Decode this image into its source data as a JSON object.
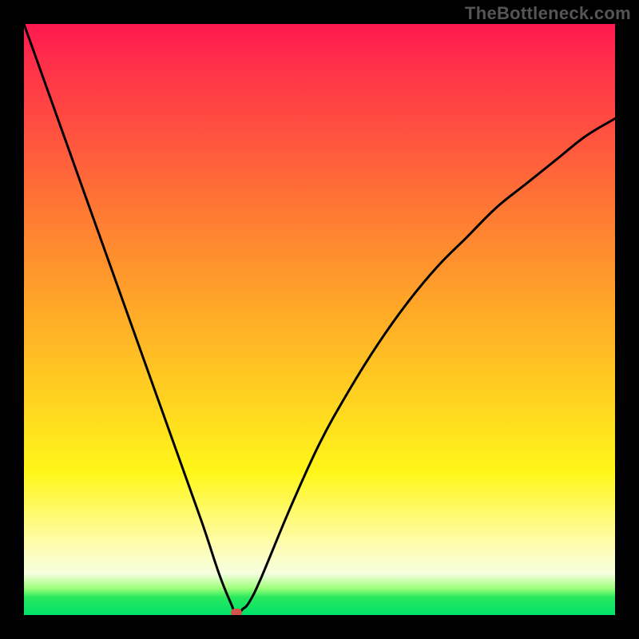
{
  "watermark": "TheBottleneck.com",
  "colors": {
    "page_background": "#000000",
    "gradient_stops": [
      "#ff1850",
      "#ff2e4a",
      "#ff5040",
      "#ff7a33",
      "#ffa828",
      "#ffd420",
      "#fff71a",
      "#fffcae",
      "#f6ffe0",
      "#9cff7a",
      "#29e85e",
      "#00e26a"
    ],
    "curve_stroke": "#000000",
    "marker_fill": "#d4534a"
  },
  "chart_data": {
    "type": "line",
    "title": "",
    "xlabel": "",
    "ylabel": "",
    "xlim": [
      0,
      100
    ],
    "ylim": [
      0,
      100
    ],
    "grid": false,
    "legend": false,
    "notes": "Background is a smooth vertical red→green heat gradient; the black curve is a V-shaped bottleneck dip. x≈balance parameter (0–100), y≈bottleneck % (0 = perfect, 100 = worst). Minimum at (36, 0). Values estimated from pixel positions.",
    "series": [
      {
        "name": "bottleneck-curve",
        "x": [
          0,
          5,
          10,
          15,
          20,
          25,
          30,
          33,
          35,
          36,
          37,
          38,
          40,
          45,
          50,
          55,
          60,
          65,
          70,
          75,
          80,
          85,
          90,
          95,
          100
        ],
        "values": [
          100,
          86,
          72,
          58,
          44,
          30,
          16,
          7,
          2,
          0,
          1,
          2,
          6,
          18,
          29,
          38,
          46,
          53,
          59,
          64,
          69,
          73,
          77,
          81,
          84
        ]
      }
    ],
    "annotations": [
      {
        "name": "min-marker",
        "x": 36,
        "y": 0,
        "color": "#d4534a"
      }
    ]
  }
}
